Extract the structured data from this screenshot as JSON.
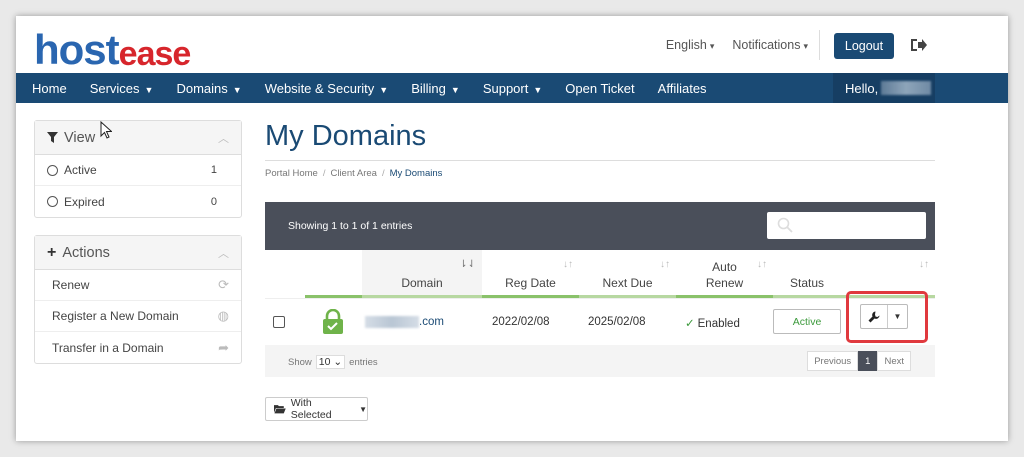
{
  "header": {
    "logo_part1": "host",
    "logo_part2": "ease",
    "language": "English",
    "notifications": "Notifications",
    "logout": "Logout"
  },
  "nav": {
    "items": [
      {
        "label": "Home",
        "caret": false
      },
      {
        "label": "Services",
        "caret": true
      },
      {
        "label": "Domains",
        "caret": true
      },
      {
        "label": "Website & Security",
        "caret": true
      },
      {
        "label": "Billing",
        "caret": true
      },
      {
        "label": "Support",
        "caret": true
      },
      {
        "label": "Open Ticket",
        "caret": false
      },
      {
        "label": "Affiliates",
        "caret": false
      }
    ],
    "greeting": "Hello,"
  },
  "sidebar": {
    "view": {
      "title": "View",
      "items": [
        {
          "label": "Active",
          "count": "1"
        },
        {
          "label": "Expired",
          "count": "0"
        }
      ]
    },
    "actions": {
      "title": "Actions",
      "items": [
        {
          "label": "Renew",
          "icon": "refresh-icon"
        },
        {
          "label": "Register a New Domain",
          "icon": "globe-icon"
        },
        {
          "label": "Transfer in a Domain",
          "icon": "share-icon"
        }
      ]
    }
  },
  "main": {
    "title": "My Domains",
    "breadcrumb": [
      "Portal Home",
      "Client Area",
      "My Domains"
    ],
    "showing": "Showing 1 to 1 of 1 entries",
    "columns": {
      "domain": "Domain",
      "reg_date": "Reg Date",
      "next_due": "Next Due",
      "auto_renew_1": "Auto",
      "auto_renew_2": "Renew",
      "status": "Status"
    },
    "row": {
      "domain_suffix": ".com",
      "reg_date": "2022/02/08",
      "next_due": "2025/02/08",
      "auto_renew": "Enabled",
      "status": "Active"
    },
    "footer": {
      "show": "Show",
      "entries_value": "10",
      "entries": "entries",
      "previous": "Previous",
      "page": "1",
      "next": "Next"
    },
    "with_selected": "With Selected"
  },
  "colors": {
    "brand_blue": "#1a4a74",
    "logo_blue": "#2a66b0",
    "logo_red": "#d7262c",
    "active_green": "#3c9a3c",
    "highlight_red": "#e0393e",
    "table_header": "#4a4f5a"
  }
}
